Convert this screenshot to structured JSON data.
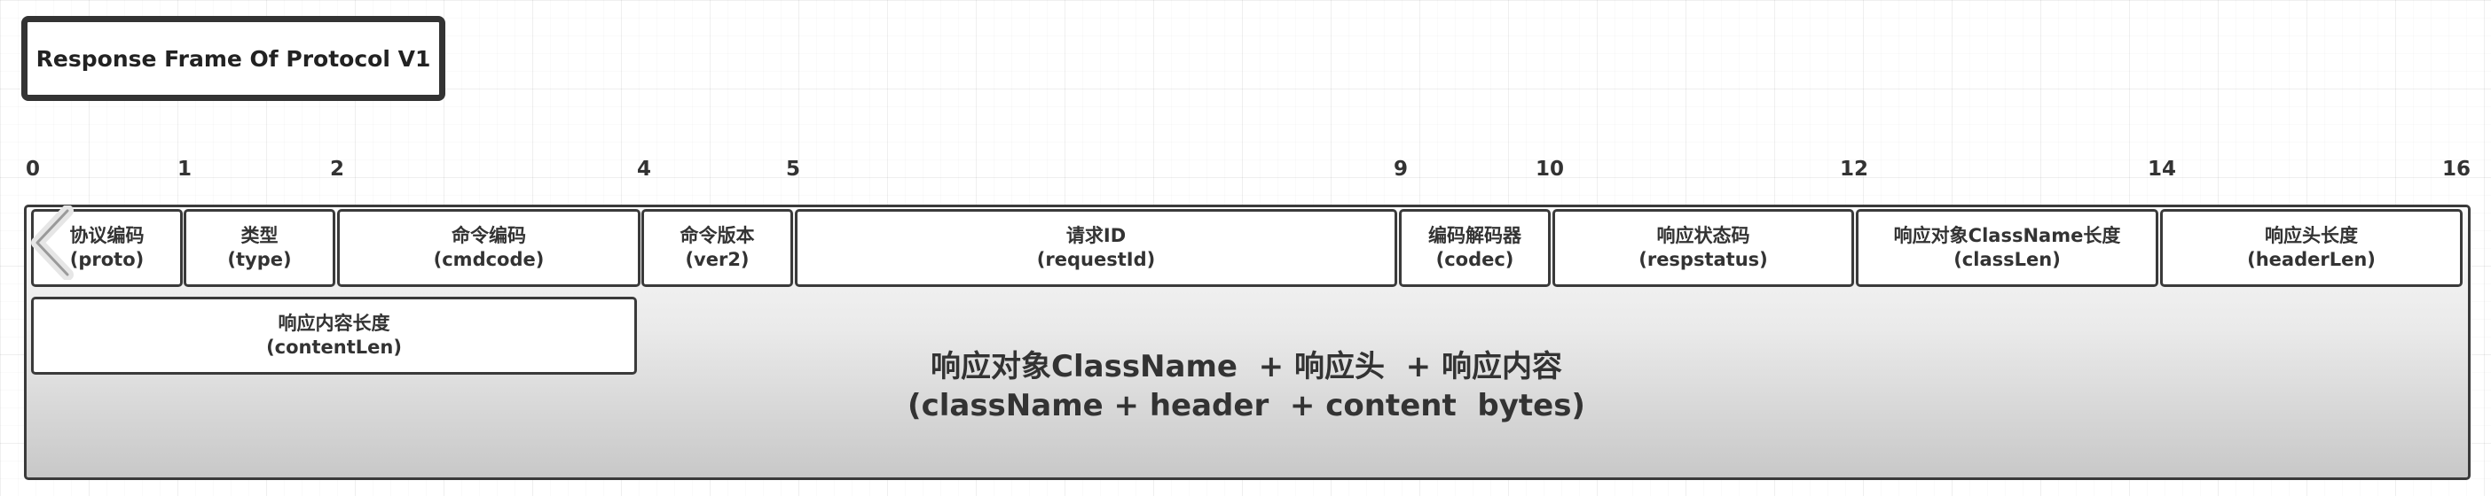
{
  "title": "Response Frame Of Protocol V1",
  "ruler": [
    "0",
    "1",
    "2",
    "4",
    "5",
    "9",
    "10",
    "12",
    "14",
    "16"
  ],
  "fields": [
    {
      "name": "协议编码",
      "id": "(proto)"
    },
    {
      "name": "类型",
      "id": "(type)"
    },
    {
      "name": "命令编码",
      "id": "(cmdcode)"
    },
    {
      "name": "命令版本",
      "id": "(ver2)"
    },
    {
      "name": "请求ID",
      "id": "(requestId)"
    },
    {
      "name": "编码解码器",
      "id": "(codec)"
    },
    {
      "name": "响应状态码",
      "id": "(respstatus)"
    },
    {
      "name": "响应对象ClassName长度",
      "id": "(classLen)"
    },
    {
      "name": "响应头长度",
      "id": "(headerLen)"
    },
    {
      "name": "响应内容长度",
      "id": "(contentLen)"
    }
  ],
  "payload": {
    "line1": "响应对象ClassName  + 响应头  + 响应内容",
    "line2": "(className + header  + content  bytes)"
  }
}
